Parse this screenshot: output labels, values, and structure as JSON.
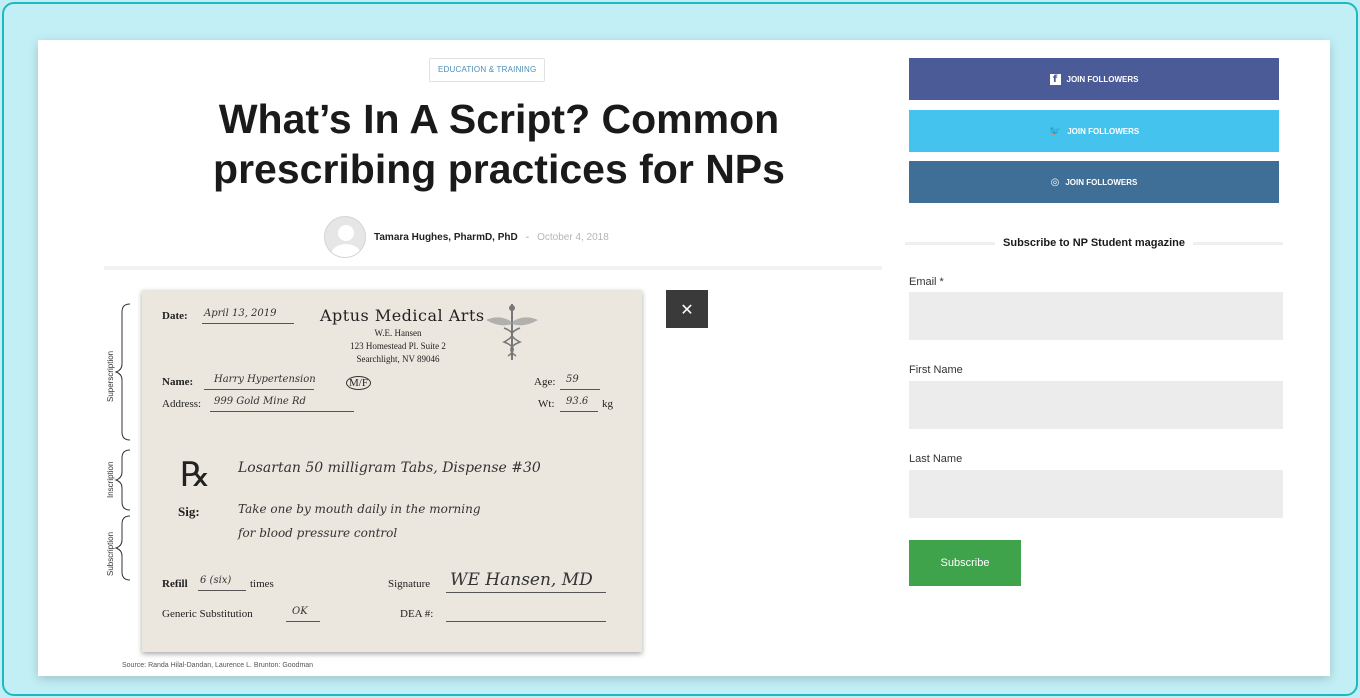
{
  "article": {
    "category": "EDUCATION & TRAINING",
    "title": "What’s In A Script? Common prescribing practices for NPs",
    "author": "Tamara Hughes, PharmD, PhD",
    "separator": "-",
    "date": "October 4, 2018",
    "image_close": "✕",
    "source_caption": "Source: Randa Hilal-Dandan, Laurence L. Brunton: Goodman"
  },
  "prescription": {
    "date_label": "Date:",
    "date_value": "April 13, 2019",
    "clinic_name": "Aptus Medical Arts",
    "clinic_person": "W.E. Hansen",
    "clinic_address1": "123 Homestead Pl. Suite 2",
    "clinic_address2": "Searchlight, NV 89046",
    "name_label": "Name:",
    "name_value": "Harry Hypertension",
    "sex": "M/F",
    "age_label": "Age:",
    "age_value": "59",
    "address_label": "Address:",
    "address_value": "999 Gold Mine Rd",
    "wt_label": "Wt:",
    "wt_value": "93.6",
    "wt_unit": "kg",
    "rx_symbol": "℞",
    "inscription": "Losartan 50 milligram Tabs, Dispense #30",
    "sig_label": "Sig:",
    "sig_line1": "Take one by mouth daily in the morning",
    "sig_line2": "for blood pressure control",
    "refill_label": "Refill",
    "refill_value": "6 (six)",
    "refill_suffix": "times",
    "signature_label": "Signature",
    "signature_value": "WE Hansen, MD",
    "generic_label": "Generic Substitution",
    "generic_value": "OK",
    "dea_label": "DEA #:",
    "side_superscription": "Superscription",
    "side_inscription": "Inscription",
    "side_subscription": "Subscription"
  },
  "sidebar": {
    "facebook_label": "JOIN FOLLOWERS",
    "twitter_label": "JOIN FOLLOWERS",
    "instagram_label": "JOIN FOLLOWERS",
    "facebook_icon": "f",
    "twitter_icon": "🐦",
    "instagram_icon": "◎",
    "subscribe_heading": "Subscribe to NP Student magazine",
    "email_label": "Email *",
    "first_name_label": "First Name",
    "last_name_label": "Last Name",
    "subscribe_button": "Subscribe"
  },
  "colors": {
    "facebook": "#4b5b98",
    "twitter": "#45c3ef",
    "instagram": "#3f6f96",
    "subscribe": "#3ea34a",
    "frame_border": "#1fb8bf"
  }
}
